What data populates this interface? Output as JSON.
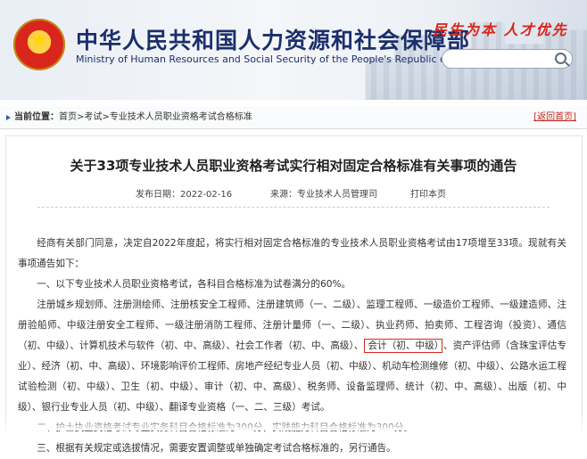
{
  "header": {
    "ministry_cn": "中华人民共和国人力资源和社会保障部",
    "ministry_en": "Ministry of Human Resources and Social Security of the People's Republic of China",
    "slogan": "民生为本 人才优先",
    "search_placeholder": ""
  },
  "breadcrumb": {
    "label": "当前位置：",
    "items": [
      "首页",
      "考试",
      "专业技术人员职业资格考试合格标准"
    ],
    "separator": ">",
    "back": "[返回首页]"
  },
  "article": {
    "title": "关于33项专业技术人员职业资格考试实行相对固定合格标准有关事项的通告",
    "published": "发布日期：2022-02-16",
    "source": "来源：专业技术人员管理司",
    "print": "打印本页",
    "intro": "经商有关部门同意，决定自2022年度起，将实行相对固定合格标准的专业技术人员职业资格考试由17项增至33项。现就有关事项通告如下：",
    "item1_heading": "一、以下专业技术人员职业资格考试，各科目合格标准为试卷满分的60%。",
    "item1_before": "注册城乡规划师、注册测绘师、注册核安全工程师、注册建筑师（一、二级）、监理工程师、一级造价工程师、一级建造师、注册验船师、中级注册安全工程师、一级注册消防工程师、注册计量师（一、二级）、执业药师、拍卖师、工程咨询（投资）、通信（初、中级）、计算机技术与软件（初、中、高级）、社会工作者（初、中、高级）、",
    "item1_highlight": "会计（初、中级）",
    "item1_after": "、资产评估师（含珠宝评估专业）、经济（初、中、高级）、环境影响评价工程师、房地产经纪专业人员（初、中级）、机动车检测维修（初、中级）、公路水运工程试验检测（初、中级）、卫生（初、中级）、审计（初、中、高级）、税务师、设备监理师、统计（初、中、高级）、出版（初、中级）、银行业专业人员（初、中级）、翻译专业资格（一、二、三级）考试。",
    "item2": "二、护士执业资格考试专业实务科目合格标准为300分，实践能力科目合格标准为300分。",
    "item3": "三、根据有关规定或选拔情况，需要安置调整或单独确定考试合格标准的，另行通告。"
  },
  "colors": {
    "brand_blue": "#1b2f6b",
    "accent_red": "#d9261c"
  }
}
